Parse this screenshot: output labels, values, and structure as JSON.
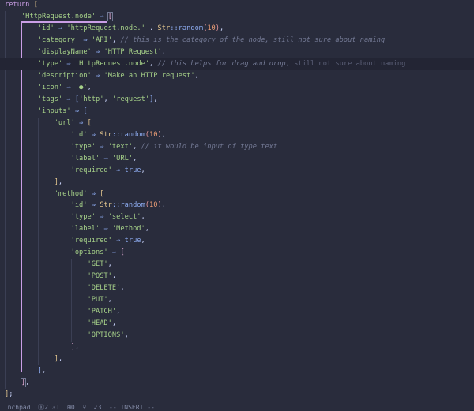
{
  "editor": {
    "cursor_line": 5,
    "lines": [
      {
        "indent": 0,
        "tokens": [
          [
            "k",
            "return"
          ],
          [
            "p",
            " "
          ],
          [
            "b1",
            "["
          ]
        ]
      },
      {
        "indent": 1,
        "tokens": [
          [
            "s",
            "'HttpRequest.node'"
          ],
          [
            "p",
            " "
          ],
          [
            "o",
            "⇒"
          ],
          [
            "p",
            " "
          ],
          [
            "b2 boxed",
            "["
          ]
        ]
      },
      {
        "indent": 2,
        "tokens": [
          [
            "s",
            "'id'"
          ],
          [
            "p",
            " "
          ],
          [
            "o",
            "⇒"
          ],
          [
            "p",
            " "
          ],
          [
            "s",
            "'httpRequest.node.'"
          ],
          [
            "p",
            " . "
          ],
          [
            "t",
            "Str"
          ],
          [
            "o",
            "::"
          ],
          [
            "f",
            "random"
          ],
          [
            "pp",
            "("
          ],
          [
            "n",
            "10"
          ],
          [
            "pp",
            ")"
          ],
          [
            "p",
            ","
          ]
        ]
      },
      {
        "indent": 2,
        "tokens": [
          [
            "s",
            "'category'"
          ],
          [
            "p",
            " "
          ],
          [
            "o",
            "⇒"
          ],
          [
            "p",
            " "
          ],
          [
            "s",
            "'API'"
          ],
          [
            "p",
            ", "
          ],
          [
            "c",
            "// this is the category of the node, still not sure about naming"
          ]
        ]
      },
      {
        "indent": 2,
        "tokens": [
          [
            "s",
            "'displayName'"
          ],
          [
            "p",
            " "
          ],
          [
            "o",
            "⇒"
          ],
          [
            "p",
            " "
          ],
          [
            "s",
            "'HTTP Request'"
          ],
          [
            "p",
            ","
          ]
        ]
      },
      {
        "indent": 2,
        "tokens": [
          [
            "s",
            "'type'"
          ],
          [
            "p",
            " "
          ],
          [
            "o",
            "⇒"
          ],
          [
            "p",
            " "
          ],
          [
            "s",
            "'HttpRequest.node'"
          ],
          [
            "p",
            ", "
          ],
          [
            "c",
            "// this helps for drag and drop"
          ],
          [
            "g",
            ", still not sure about naming"
          ]
        ]
      },
      {
        "indent": 2,
        "tokens": [
          [
            "s",
            "'description'"
          ],
          [
            "p",
            " "
          ],
          [
            "o",
            "⇒"
          ],
          [
            "p",
            " "
          ],
          [
            "s",
            "'Make an HTTP request'"
          ],
          [
            "p",
            ","
          ]
        ]
      },
      {
        "indent": 2,
        "tokens": [
          [
            "s",
            "'icon'"
          ],
          [
            "p",
            " "
          ],
          [
            "o",
            "⇒"
          ],
          [
            "p",
            " "
          ],
          [
            "s",
            "'●'"
          ],
          [
            "p",
            ","
          ]
        ]
      },
      {
        "indent": 2,
        "tokens": [
          [
            "s",
            "'tags'"
          ],
          [
            "p",
            " "
          ],
          [
            "o",
            "⇒"
          ],
          [
            "p",
            " "
          ],
          [
            "b3",
            "["
          ],
          [
            "s",
            "'http'"
          ],
          [
            "p",
            ", "
          ],
          [
            "s",
            "'request'"
          ],
          [
            "b3",
            "]"
          ],
          [
            "p",
            ","
          ]
        ]
      },
      {
        "indent": 2,
        "tokens": [
          [
            "s",
            "'inputs'"
          ],
          [
            "p",
            " "
          ],
          [
            "o",
            "⇒"
          ],
          [
            "p",
            " "
          ],
          [
            "b3",
            "["
          ]
        ]
      },
      {
        "indent": 3,
        "tokens": [
          [
            "s",
            "'url'"
          ],
          [
            "p",
            " "
          ],
          [
            "o",
            "⇒"
          ],
          [
            "p",
            " "
          ],
          [
            "b1",
            "["
          ]
        ]
      },
      {
        "indent": 4,
        "tokens": [
          [
            "s",
            "'id'"
          ],
          [
            "p",
            " "
          ],
          [
            "o",
            "⇒"
          ],
          [
            "p",
            " "
          ],
          [
            "t",
            "Str"
          ],
          [
            "o",
            "::"
          ],
          [
            "f",
            "random"
          ],
          [
            "pp",
            "("
          ],
          [
            "n",
            "10"
          ],
          [
            "pp",
            ")"
          ],
          [
            "p",
            ","
          ]
        ]
      },
      {
        "indent": 4,
        "tokens": [
          [
            "s",
            "'type'"
          ],
          [
            "p",
            " "
          ],
          [
            "o",
            "⇒"
          ],
          [
            "p",
            " "
          ],
          [
            "s",
            "'text'"
          ],
          [
            "p",
            ", "
          ],
          [
            "c",
            "// it would be input of type text"
          ]
        ]
      },
      {
        "indent": 4,
        "tokens": [
          [
            "s",
            "'label'"
          ],
          [
            "p",
            " "
          ],
          [
            "o",
            "⇒"
          ],
          [
            "p",
            " "
          ],
          [
            "s",
            "'URL'"
          ],
          [
            "p",
            ","
          ]
        ]
      },
      {
        "indent": 4,
        "tokens": [
          [
            "s",
            "'required'"
          ],
          [
            "p",
            " "
          ],
          [
            "o",
            "⇒"
          ],
          [
            "p",
            " "
          ],
          [
            "bool",
            "true"
          ],
          [
            "p",
            ","
          ]
        ]
      },
      {
        "indent": 3,
        "tokens": [
          [
            "b1",
            "]"
          ],
          [
            "p",
            ","
          ]
        ]
      },
      {
        "indent": 3,
        "tokens": [
          [
            "s",
            "'method'"
          ],
          [
            "p",
            " "
          ],
          [
            "o",
            "⇒"
          ],
          [
            "p",
            " "
          ],
          [
            "b1",
            "["
          ]
        ]
      },
      {
        "indent": 4,
        "tokens": [
          [
            "s",
            "'id'"
          ],
          [
            "p",
            " "
          ],
          [
            "o",
            "⇒"
          ],
          [
            "p",
            " "
          ],
          [
            "t",
            "Str"
          ],
          [
            "o",
            "::"
          ],
          [
            "f",
            "random"
          ],
          [
            "pp",
            "("
          ],
          [
            "n",
            "10"
          ],
          [
            "pp",
            ")"
          ],
          [
            "p",
            ","
          ]
        ]
      },
      {
        "indent": 4,
        "tokens": [
          [
            "s",
            "'type'"
          ],
          [
            "p",
            " "
          ],
          [
            "o",
            "⇒"
          ],
          [
            "p",
            " "
          ],
          [
            "s",
            "'select'"
          ],
          [
            "p",
            ","
          ]
        ]
      },
      {
        "indent": 4,
        "tokens": [
          [
            "s",
            "'label'"
          ],
          [
            "p",
            " "
          ],
          [
            "o",
            "⇒"
          ],
          [
            "p",
            " "
          ],
          [
            "s",
            "'Method'"
          ],
          [
            "p",
            ","
          ]
        ]
      },
      {
        "indent": 4,
        "tokens": [
          [
            "s",
            "'required'"
          ],
          [
            "p",
            " "
          ],
          [
            "o",
            "⇒"
          ],
          [
            "p",
            " "
          ],
          [
            "bool",
            "true"
          ],
          [
            "p",
            ","
          ]
        ]
      },
      {
        "indent": 4,
        "tokens": [
          [
            "s",
            "'options'"
          ],
          [
            "p",
            " "
          ],
          [
            "o",
            "⇒"
          ],
          [
            "p",
            " "
          ],
          [
            "b2",
            "["
          ]
        ]
      },
      {
        "indent": 5,
        "tokens": [
          [
            "s",
            "'GET'"
          ],
          [
            "p",
            ","
          ]
        ]
      },
      {
        "indent": 5,
        "tokens": [
          [
            "s",
            "'POST'"
          ],
          [
            "p",
            ","
          ]
        ]
      },
      {
        "indent": 5,
        "tokens": [
          [
            "s",
            "'DELETE'"
          ],
          [
            "p",
            ","
          ]
        ]
      },
      {
        "indent": 5,
        "tokens": [
          [
            "s",
            "'PUT'"
          ],
          [
            "p",
            ","
          ]
        ]
      },
      {
        "indent": 5,
        "tokens": [
          [
            "s",
            "'PATCH'"
          ],
          [
            "p",
            ","
          ]
        ]
      },
      {
        "indent": 5,
        "tokens": [
          [
            "s",
            "'HEAD'"
          ],
          [
            "p",
            ","
          ]
        ]
      },
      {
        "indent": 5,
        "tokens": [
          [
            "s",
            "'OPTIONS'"
          ],
          [
            "p",
            ","
          ]
        ]
      },
      {
        "indent": 4,
        "tokens": [
          [
            "b2",
            "]"
          ],
          [
            "p",
            ","
          ]
        ]
      },
      {
        "indent": 3,
        "tokens": [
          [
            "b1",
            "]"
          ],
          [
            "p",
            ","
          ]
        ]
      },
      {
        "indent": 2,
        "tokens": [
          [
            "b3",
            "]"
          ],
          [
            "p",
            ","
          ]
        ]
      },
      {
        "indent": 1,
        "tokens": [
          [
            "b2 boxed",
            "]"
          ],
          [
            "p",
            ","
          ]
        ]
      },
      {
        "indent": 0,
        "tokens": [
          [
            "b1",
            "]"
          ],
          [
            "p",
            ";"
          ]
        ]
      }
    ]
  },
  "status_bar": {
    "text": "nchpad  ⓧ2 ⚠1  ⊞0  ⑂  ✓3  -- INSERT --"
  }
}
